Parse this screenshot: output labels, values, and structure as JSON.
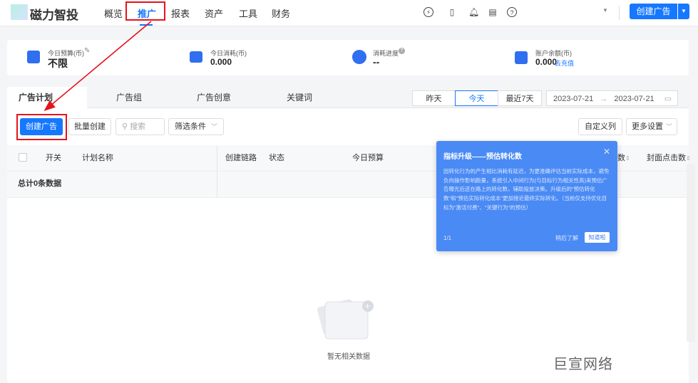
{
  "header": {
    "logo": "磁力智投",
    "nav": [
      "概览",
      "推广",
      "报表",
      "资产",
      "工具",
      "财务"
    ],
    "active_nav": "推广",
    "create_button": "创建广告"
  },
  "stats": [
    {
      "label": "今日预算(币)",
      "value": "不限"
    },
    {
      "label": "今日消耗(币)",
      "value": "0.000"
    },
    {
      "label": "消耗进度",
      "value": "--"
    },
    {
      "label": "账户余额(币)",
      "value": "0.000",
      "link": "去充值"
    }
  ],
  "tabs": [
    "广告计划",
    "广告组",
    "广告创意",
    "关键词"
  ],
  "date_range": {
    "options": [
      "昨天",
      "今天",
      "最近7天"
    ],
    "selected": "今天",
    "start": "2023-07-21",
    "end": "2023-07-21"
  },
  "toolbar": {
    "create": "创建广告",
    "batch": "批量创建",
    "search_placeholder": "搜索",
    "filter": "筛选条件",
    "custom_columns": "自定义列",
    "more_settings": "更多设置"
  },
  "table": {
    "columns": [
      "开关",
      "计划名称",
      "创建链路",
      "状态",
      "今日预算",
      "数",
      "封面点击数"
    ],
    "total": "总计0条数据",
    "empty": "暂无相关数据"
  },
  "popover": {
    "title": "指标升级——预估转化数",
    "body": "因转化行为的产生相比消耗有延迟，为更准确评估当前实际成本，避免负向操作影响跑量，系统引入中间行为(与目标行为相关性高)来预估广告曝光后还在路上的转化数，辅助投放决策。升级后的\"预估转化数\"和\"预估实际转化成本\"更加接近最终实际转化。（当前仅支持优化目标为\"激活付费\"、\"关键行为\"的预估）",
    "page": "1/1",
    "later": "稍后了解",
    "ok": "知道啦"
  },
  "watermark": "巨宣网络"
}
